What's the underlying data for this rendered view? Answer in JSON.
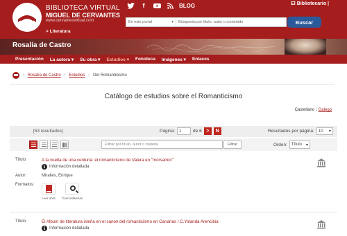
{
  "header": {
    "brand_line1": "BIBLIOTECA VIRTUAL",
    "brand_line2": "MIGUEL DE CERVANTES",
    "brand_url": "www.cervantesvirtual.com",
    "section": "> Literatura",
    "blog_label": "BLOG",
    "biblio_link": "El Bibliotecario  |",
    "search": {
      "scope": "En este portal",
      "placeholder": "Búsqueda por título, autor o contenido",
      "button": "Buscar"
    }
  },
  "banner": {
    "title": "Rosalía de Castro"
  },
  "nav": {
    "items": [
      "Presentación",
      "La autora ▾",
      "Su obra ▾",
      "Estudios ▾",
      "Fonoteca",
      "Imágenes ▾",
      "Enlaces"
    ],
    "active_index": 3
  },
  "breadcrumb": {
    "items": [
      "Rosalía de Castro",
      "Estudios",
      "Del Romanticismo"
    ],
    "separator": "/"
  },
  "page": {
    "title": "Catálogo de estudios sobre el Romanticismo",
    "lang_current": "Castellano",
    "lang_alt": "Galego"
  },
  "pager": {
    "count": "[53 resultados]",
    "page_label": "Página:",
    "page_value": "1",
    "of_label": "de 6",
    "next": ">",
    "last": "N",
    "rpp_label": "Resultados por página:",
    "rpp_value": "10"
  },
  "tools": {
    "filter_placeholder": "Filtrar por título, autor o materia",
    "filter_button": "Filtrar",
    "order_label": "Orden:",
    "order_value": "Título"
  },
  "labels": {
    "title": "Título:",
    "author": "Autor:",
    "formats": "Formatos:",
    "info": "Información detallada",
    "read": "Leer obra",
    "concord": "Concordancias"
  },
  "results": [
    {
      "title": "A la vuelta de una centuria: el romanticismo de Valera en \"morsamor\"",
      "author": "Miralles, Enrique"
    },
    {
      "title": "El Album de literatura isleña en el canon del romanticismo en Canarias / C.Yolanda Arencibia"
    }
  ],
  "colors": {
    "brand_red": "#a51d1d",
    "button_blue": "#2b5a9b",
    "nav_active": "#f5b6a0"
  }
}
